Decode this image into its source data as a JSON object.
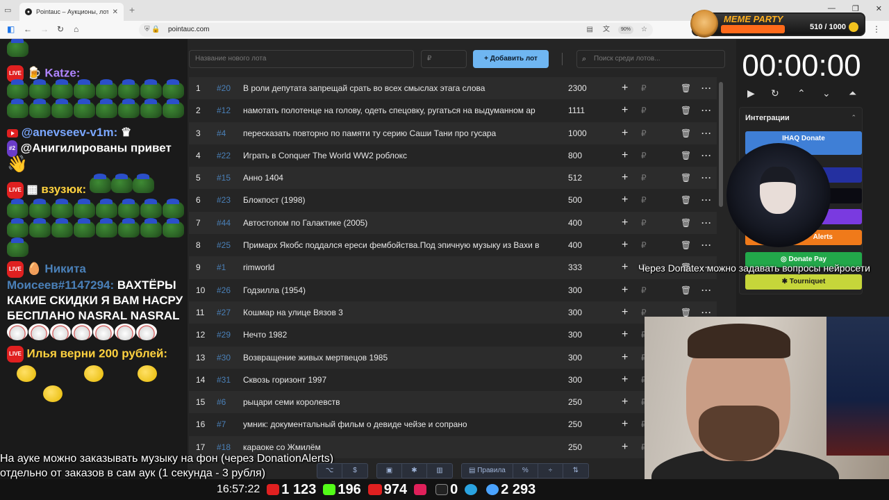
{
  "browser": {
    "tab_title": "Pointauc – Аукционы, лотерея",
    "url": "pointauc.com",
    "zoom": "90%"
  },
  "meme_party": {
    "title": "MEME PARTY",
    "progress": "510 / 1000",
    "fill_fraction": 0.51
  },
  "chat": {
    "messages": [
      {
        "user": "Katze:",
        "color": "#b084ff"
      },
      {
        "user": "@anevseev-v1m:",
        "color": "#7aa7ff",
        "badge": "#2",
        "text": "@Анигилированы привет"
      },
      {
        "user": "взузюк:",
        "color": "#ffd23f"
      },
      {
        "user": "Никита Моисеев#1147294:",
        "color": "#4a80b8",
        "text": "ВАХТЁРЫ КАКИЕ СКИДКИ Я ВАМ НАСРУ БЕСПЛАНО NASRAL NASRAL"
      },
      {
        "user": "Илья верни 200 рублей:",
        "color": "#ffd23f"
      }
    ]
  },
  "controls": {
    "new_lot_placeholder": "Название нового лота",
    "price_placeholder": "₽",
    "add_button": "Добавить лот",
    "search_placeholder": "Поиск среди лотов..."
  },
  "lots": [
    {
      "n": "1",
      "id": "#20",
      "name": "В роли депутата запрещай срать во всех смыслах этага слова",
      "amount": "2300"
    },
    {
      "n": "2",
      "id": "#12",
      "name": "намотать полотенце на голову, одеть спецовку, ругаться на выдуманном ар",
      "amount": "1111"
    },
    {
      "n": "3",
      "id": "#4",
      "name": "пересказать повторно по памяти ту серию Саши Тани про гусара",
      "amount": "1000"
    },
    {
      "n": "4",
      "id": "#22",
      "name": "Играть в Conquer The World WW2 роблокс",
      "amount": "800"
    },
    {
      "n": "5",
      "id": "#15",
      "name": "Анно 1404",
      "amount": "512"
    },
    {
      "n": "6",
      "id": "#23",
      "name": "Блокпост (1998)",
      "amount": "500"
    },
    {
      "n": "7",
      "id": "#44",
      "name": "Автостопом по Галактике (2005)",
      "amount": "400"
    },
    {
      "n": "8",
      "id": "#25",
      "name": "Примарх Якобс поддался ереси фембойства.Под эпичную музыку из Вахи в",
      "amount": "400"
    },
    {
      "n": "9",
      "id": "#1",
      "name": "rimworld",
      "amount": "333"
    },
    {
      "n": "10",
      "id": "#26",
      "name": "Годзилла (1954)",
      "amount": "300"
    },
    {
      "n": "11",
      "id": "#27",
      "name": "Кошмар на улице Вязов 3",
      "amount": "300"
    },
    {
      "n": "12",
      "id": "#29",
      "name": "Нечто 1982",
      "amount": "300"
    },
    {
      "n": "13",
      "id": "#30",
      "name": "Возвращение живых мертвецов 1985",
      "amount": "300"
    },
    {
      "n": "14",
      "id": "#31",
      "name": "Сквозь горизонт 1997",
      "amount": "300"
    },
    {
      "n": "15",
      "id": "#6",
      "name": "рыцари семи королевств",
      "amount": "250"
    },
    {
      "n": "16",
      "id": "#7",
      "name": "умник: документальный фильм о девиде чейзе и сопрано",
      "amount": "250"
    },
    {
      "n": "17",
      "id": "#18",
      "name": "караоке со Жмилём",
      "amount": "250"
    }
  ],
  "rub_sign": "₽",
  "timer": "00:00:00",
  "integrations": {
    "title": "Интеграции",
    "items": [
      {
        "label": "IHAQ Donate",
        "color": "#3f7fd6"
      },
      {
        "label": "Donate Pay",
        "color": "#22a84a"
      },
      {
        "label": "Tourniquet",
        "color": "#c6d63a"
      }
    ],
    "alerts_label": "Alerts"
  },
  "overlay": {
    "donatex": "Через Donatex можно задавать вопросы нейросети",
    "sub1": "На ауке можно заказывать музыку на фон (через DonationAlerts)",
    "sub2": "отдельно от заказов в сам аук (1 секунда - 3 рубля)"
  },
  "toolbar": {
    "rules": "Правила"
  },
  "stats": {
    "clock": "16:57:22",
    "youtube": "1 123",
    "kick": "196",
    "live": "974",
    "rutube": "0",
    "telegram": "2 293"
  }
}
